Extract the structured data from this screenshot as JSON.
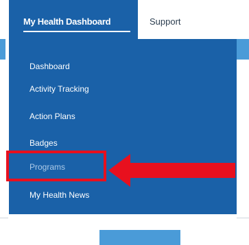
{
  "nav": {
    "tabs": [
      {
        "label": "My Health Dashboard",
        "active": true
      },
      {
        "label": "Support",
        "active": false
      }
    ]
  },
  "dropdown": {
    "items": [
      {
        "label": "Dashboard"
      },
      {
        "label": "Activity Tracking"
      },
      {
        "label": "Action Plans"
      },
      {
        "label": "Badges"
      },
      {
        "label": "Programs",
        "highlighted": true
      },
      {
        "label": "My Health News"
      }
    ]
  },
  "colors": {
    "nav_active_bg": "#1a61a8",
    "annotation": "#e8101e",
    "accent_blue": "#4a9bd8"
  },
  "icons": {
    "annotation_pointer": "left-arrow-icon"
  }
}
